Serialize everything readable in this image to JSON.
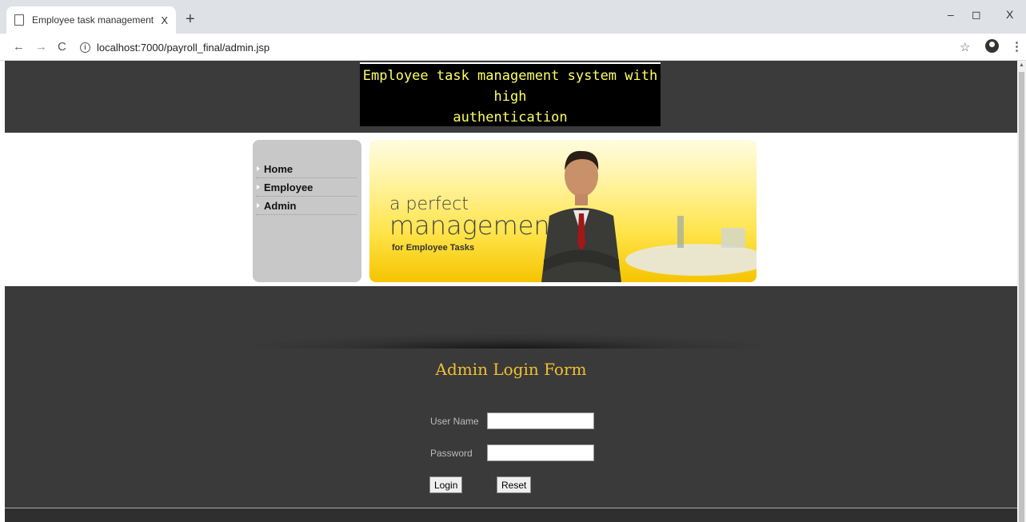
{
  "browser": {
    "tab_title": "Employee task management syst",
    "tab_close": "X",
    "new_tab": "+",
    "url": "localhost:7000/payroll_final/admin.jsp",
    "window_controls": {
      "minimize": "–",
      "maximize": "◻",
      "close": "X"
    },
    "nav": {
      "back": "←",
      "forward": "→",
      "reload": "C"
    }
  },
  "site": {
    "title_line1": "Employee task management system with high",
    "title_line2": "authentication"
  },
  "menu": {
    "items": [
      {
        "label": "Home"
      },
      {
        "label": "Employee"
      },
      {
        "label": "Admin"
      }
    ]
  },
  "hero": {
    "line1": "a perfect",
    "line2": "management",
    "line3": "for Employee Tasks"
  },
  "login_form": {
    "title": "Admin Login Form",
    "username_label": "User Name",
    "username_value": "",
    "password_label": "Password",
    "password_value": "",
    "login_button": "Login",
    "reset_button": "Reset"
  },
  "colors": {
    "header_bg": "#3b3b3b",
    "title_text": "#ffff66",
    "form_title": "#f0c030",
    "hero_yellow": "#ffe44a"
  }
}
